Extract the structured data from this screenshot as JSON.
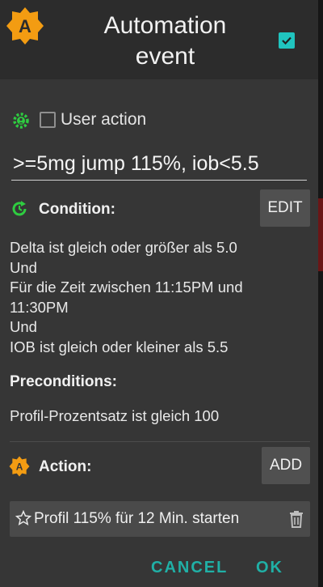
{
  "header": {
    "app_icon_letter": "A",
    "title": "Automation\nevent",
    "enabled_checked": true
  },
  "user_action": {
    "label": "User action",
    "checked": false
  },
  "event_name": {
    "value": ">=5mg jump 115%, iob<5.5"
  },
  "condition": {
    "label": "Condition:",
    "edit_button": "EDIT",
    "lines": [
      "Delta ist gleich oder größer als 5.0",
      "Und",
      "Für die Zeit zwischen 11:15PM und 11:30PM",
      "Und",
      "IOB ist gleich oder kleiner als 5.5"
    ]
  },
  "preconditions": {
    "label": "Preconditions:",
    "text": "Profil-Prozentsatz ist gleich 100"
  },
  "action": {
    "label": "Action:",
    "add_button": "ADD",
    "action_icon_letter": "A",
    "items": [
      {
        "text": "Profil 115% für 12 Min. starten"
      }
    ]
  },
  "buttons": {
    "cancel": "CANCEL",
    "ok": "OK"
  },
  "colors": {
    "accent_teal": "#20b0a6",
    "badge_orange": "#f39c12",
    "condition_green": "#2ecc40"
  }
}
